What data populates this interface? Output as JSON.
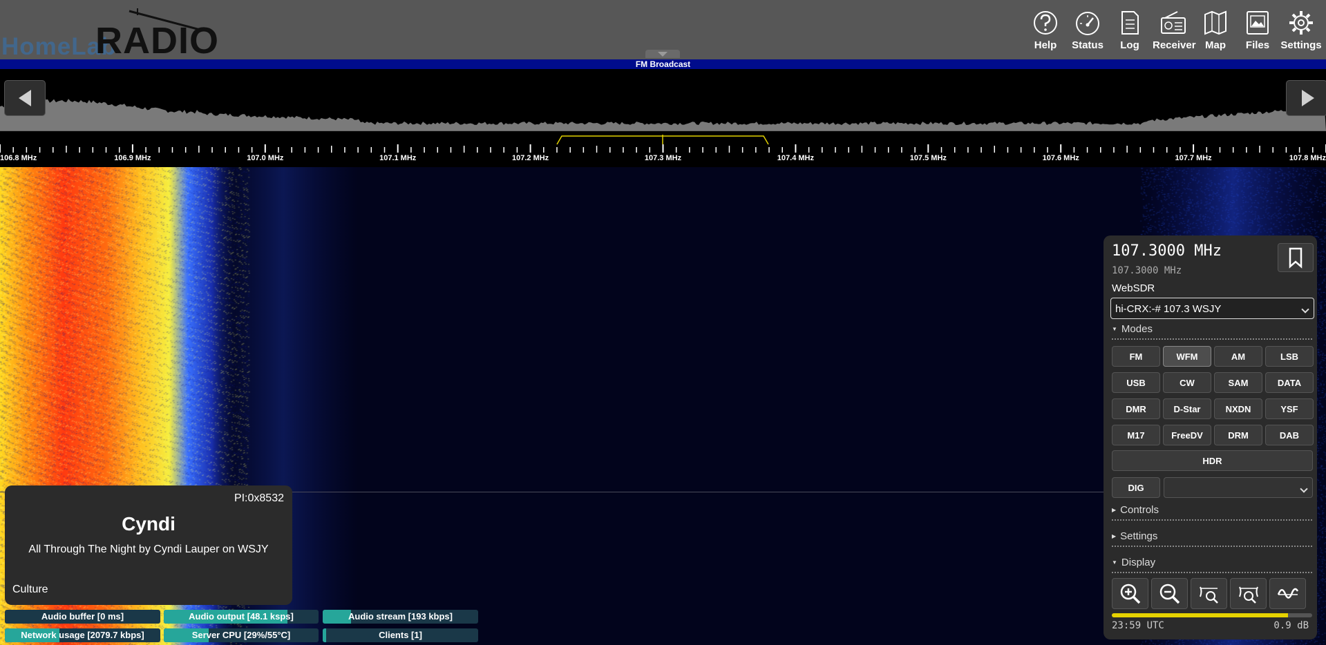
{
  "header": {
    "logo_part1": "HomeLab",
    "logo_part2": "RADIO",
    "nav": [
      {
        "label": "Help",
        "icon": "help-icon"
      },
      {
        "label": "Status",
        "icon": "gauge-icon"
      },
      {
        "label": "Log",
        "icon": "log-icon"
      },
      {
        "label": "Receiver",
        "icon": "radio-icon"
      },
      {
        "label": "Map",
        "icon": "map-icon"
      },
      {
        "label": "Files",
        "icon": "files-icon"
      },
      {
        "label": "Settings",
        "icon": "gear-icon"
      }
    ]
  },
  "band": {
    "name": "FM Broadcast"
  },
  "scale": {
    "labels": [
      "106.8 MHz",
      "106.9 MHz",
      "107.0 MHz",
      "107.1 MHz",
      "107.2 MHz",
      "107.3 MHz",
      "107.4 MHz",
      "107.5 MHz",
      "107.6 MHz",
      "107.7 MHz",
      "107.8 MHz"
    ]
  },
  "metadata": {
    "pi": "PI:0x8532",
    "name": "Cyndi",
    "text": "All Through The Night by Cyndi Lauper on WSJY",
    "genre": "Culture"
  },
  "status": [
    {
      "label": "Audio buffer [0 ms]",
      "fill": 0.0
    },
    {
      "label": "Audio output [48.1 ksps]",
      "fill": 0.8
    },
    {
      "label": "Audio stream [193 kbps]",
      "fill": 0.18
    },
    {
      "label": "Network usage [2079.7 kbps]",
      "fill": 0.35
    },
    {
      "label": "Server CPU [29%/55°C]",
      "fill": 0.29
    },
    {
      "label": "Clients [1]",
      "fill": 0.02
    }
  ],
  "receiver": {
    "frequency": "107.3000 MHz",
    "frequency_secondary": "107.3000 MHz",
    "profile_label": "WebSDR",
    "profile_value": "hi-CRX:-# 107.3 WSJY",
    "sections": {
      "modes": "Modes",
      "controls": "Controls",
      "settings": "Settings",
      "display": "Display"
    },
    "modes": [
      "FM",
      "WFM",
      "AM",
      "LSB",
      "USB",
      "CW",
      "SAM",
      "DATA",
      "DMR",
      "D-Star",
      "NXDN",
      "YSF",
      "M17",
      "FreeDV",
      "DRM",
      "DAB"
    ],
    "active_mode": "WFM",
    "hdr_label": "HDR",
    "dig_label": "DIG",
    "clock": "23:59 UTC",
    "level": "0.9 dB",
    "smeter_level": 0.88
  },
  "colors": {
    "accent": "#26a69a",
    "band": "#000c8c",
    "meter": "#e6d200"
  }
}
